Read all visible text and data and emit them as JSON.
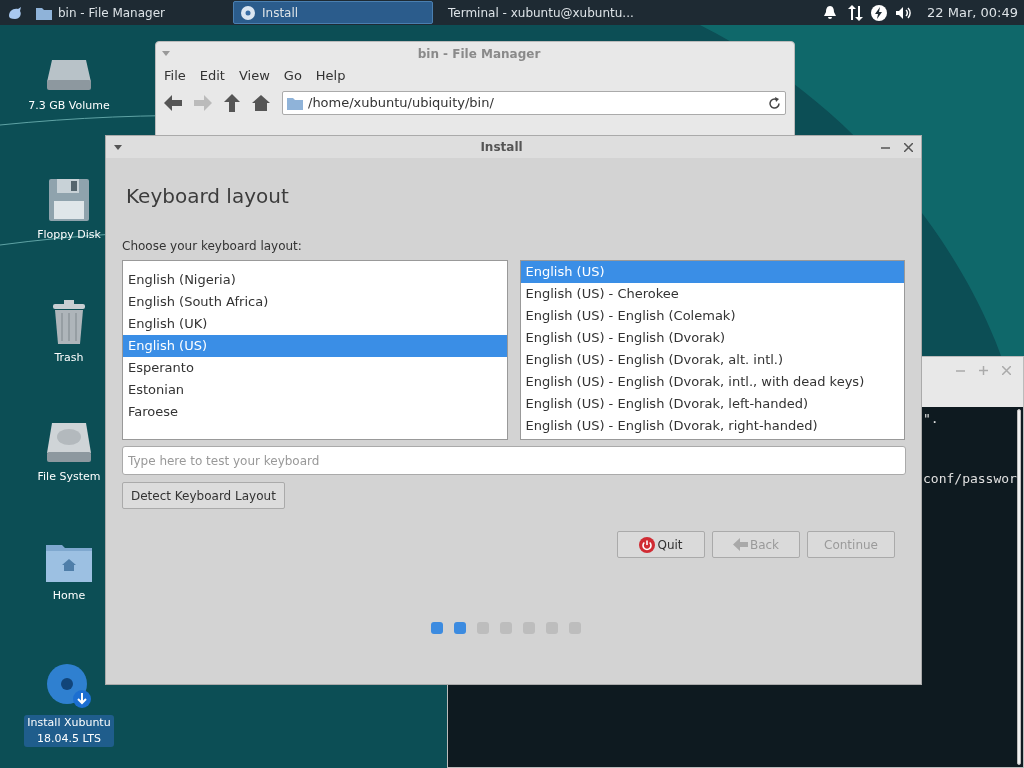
{
  "taskbar": {
    "tasks": [
      {
        "label": "bin - File Manager",
        "kind": "folder",
        "selected": false
      },
      {
        "label": "Install",
        "kind": "installer",
        "selected": true
      },
      {
        "label": "Terminal - xubuntu@xubuntu...",
        "kind": "terminal",
        "selected": false
      }
    ],
    "clock": "22 Mar, 00:49"
  },
  "desktop_icons": [
    {
      "label": "7.3 GB Volume",
      "kind": "drive",
      "selected": false
    },
    {
      "label": "Floppy Disk",
      "kind": "floppy",
      "selected": false
    },
    {
      "label": "Trash",
      "kind": "trash",
      "selected": false
    },
    {
      "label": "File System",
      "kind": "harddisk",
      "selected": false
    },
    {
      "label": "Home",
      "kind": "home",
      "selected": false
    },
    {
      "label": "Install Xubuntu 18.04.5 LTS",
      "kind": "installer",
      "selected": true
    }
  ],
  "file_manager": {
    "title": "bin - File Manager",
    "menu": [
      "File",
      "Edit",
      "View",
      "Go",
      "Help"
    ],
    "path": "/home/xubuntu/ubiquity/bin/"
  },
  "terminal": {
    "lines": [
      "\".",
      "conf/passwor"
    ]
  },
  "install": {
    "title": "Install",
    "heading": "Keyboard layout",
    "prompt": "Choose your keyboard layout:",
    "layouts": [
      {
        "label": "English (Nigeria)",
        "selected": false
      },
      {
        "label": "English (South Africa)",
        "selected": false
      },
      {
        "label": "English (UK)",
        "selected": false
      },
      {
        "label": "English (US)",
        "selected": true
      },
      {
        "label": "Esperanto",
        "selected": false
      },
      {
        "label": "Estonian",
        "selected": false
      },
      {
        "label": "Faroese",
        "selected": false
      }
    ],
    "variants": [
      {
        "label": "English (US)",
        "selected": true
      },
      {
        "label": "English (US) - Cherokee",
        "selected": false
      },
      {
        "label": "English (US) - English (Colemak)",
        "selected": false
      },
      {
        "label": "English (US) - English (Dvorak)",
        "selected": false
      },
      {
        "label": "English (US) - English (Dvorak, alt. intl.)",
        "selected": false
      },
      {
        "label": "English (US) - English (Dvorak, intl., with dead keys)",
        "selected": false
      },
      {
        "label": "English (US) - English (Dvorak, left-handed)",
        "selected": false
      },
      {
        "label": "English (US) - English (Dvorak, right-handed)",
        "selected": false
      }
    ],
    "test_field": {
      "placeholder": "Type here to test your keyboard"
    },
    "detect_button": "Detect Keyboard Layout",
    "buttons": [
      {
        "label": "Quit",
        "kind": "quit",
        "disabled": false
      },
      {
        "label": "Back",
        "kind": "back",
        "disabled": true
      },
      {
        "label": "Continue",
        "kind": "continue",
        "disabled": true
      }
    ],
    "steps": [
      {
        "done": true
      },
      {
        "done": true
      },
      {
        "done": false
      },
      {
        "done": false
      },
      {
        "done": false
      },
      {
        "done": false
      },
      {
        "done": false
      }
    ]
  }
}
